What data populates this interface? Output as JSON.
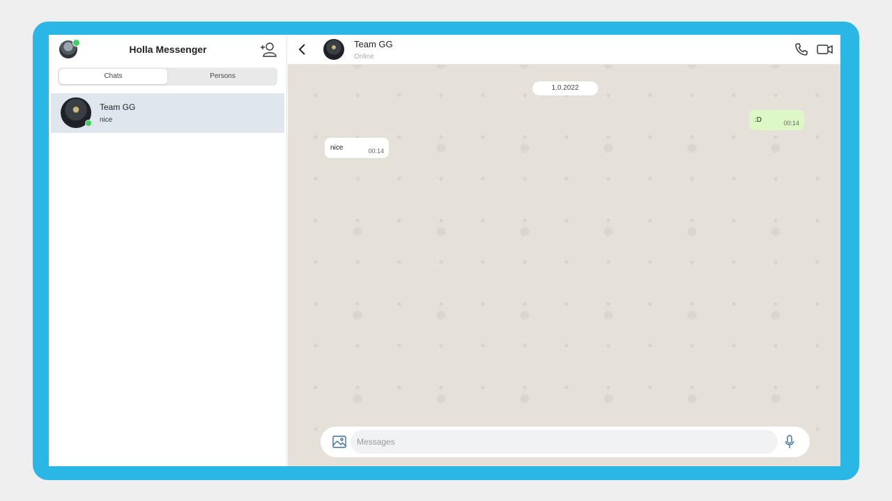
{
  "app": {
    "title": "Holla Messenger"
  },
  "sidebar": {
    "tabs": [
      {
        "label": "Chats",
        "active": true
      },
      {
        "label": "Persons",
        "active": false
      }
    ],
    "chats": [
      {
        "name": "Team GG",
        "last_message": "nice",
        "online": true
      }
    ]
  },
  "conversation": {
    "name": "Team GG",
    "status": "Online",
    "date_separator": "1.0.2022",
    "messages": [
      {
        "direction": "outgoing",
        "text": ":D",
        "time": "00:14"
      },
      {
        "direction": "incoming",
        "text": "nice",
        "time": "00:14"
      }
    ],
    "composer": {
      "placeholder": "Messages"
    }
  },
  "icons": {
    "add_user": "add-user-icon",
    "back": "chevron-left-icon",
    "call": "phone-icon",
    "video": "video-camera-icon",
    "image": "image-icon",
    "mic": "microphone-icon"
  },
  "colors": {
    "frame": "#2bb7e6",
    "selected_chat": "#dfe6ee",
    "outgoing_bubble": "#dcf8c6",
    "online": "#3ad15e",
    "chat_background": "#e5e1d9"
  }
}
